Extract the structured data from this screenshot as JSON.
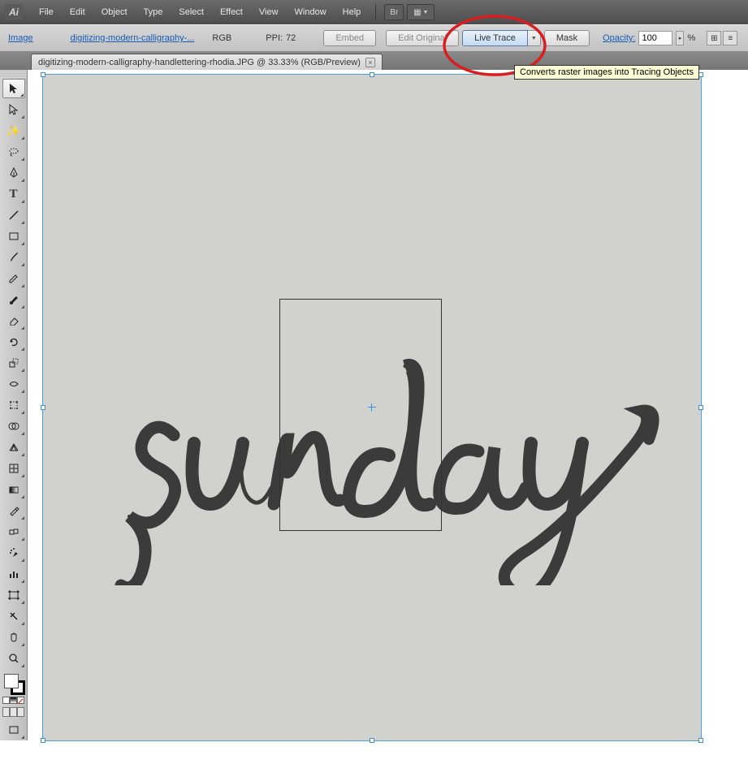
{
  "app": {
    "logo": "Ai"
  },
  "menu": {
    "items": [
      "File",
      "Edit",
      "Object",
      "Type",
      "Select",
      "Effect",
      "View",
      "Window",
      "Help"
    ],
    "bridge_icon": "Br"
  },
  "controlBar": {
    "selection_type": "Image",
    "filename_link": "digitizing-modern-calligraphy-...",
    "color_mode": "RGB",
    "ppi_label": "PPI:",
    "ppi_value": "72",
    "embed_btn": "Embed",
    "edit_original_btn": "Edit Original",
    "live_trace_btn": "Live Trace",
    "mask_btn": "Mask",
    "opacity_label": "Opacity:",
    "opacity_value": "100",
    "opacity_unit": "%"
  },
  "docTab": {
    "title": "digitizing-modern-calligraphy-handlettering-rhodia.JPG @ 33.33% (RGB/Preview)"
  },
  "tooltip": "Converts raster images into Tracing Objects",
  "canvas": {
    "lettering_word": "sunday"
  },
  "tools": [
    "selection",
    "direct-selection",
    "magic-wand",
    "lasso",
    "pen",
    "type",
    "line",
    "rectangle",
    "paintbrush",
    "pencil",
    "blob-brush",
    "eraser",
    "rotate",
    "scale",
    "width",
    "free-transform",
    "shape-builder",
    "perspective-grid",
    "mesh",
    "gradient",
    "eyedropper",
    "blend",
    "symbol-sprayer",
    "column-graph",
    "artboard",
    "slice",
    "hand",
    "zoom"
  ]
}
